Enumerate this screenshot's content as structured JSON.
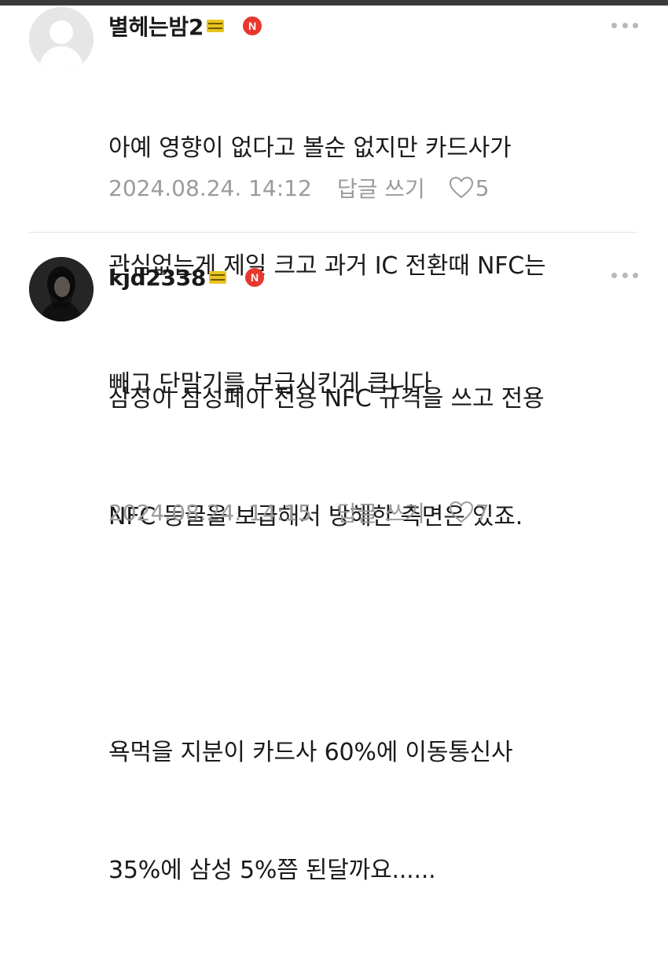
{
  "comments": [
    {
      "username": "별헤는밤2",
      "badge": "N",
      "lines": [
        "아예 영향이 없다고 볼순 없지만 카드사가",
        "관심없는게 제일 크고 과거 IC 전환때 NFC는",
        "빼고 단말기를 보급시킨게 큽니다"
      ],
      "timestamp": "2024.08.24. 14:12",
      "reply_label": "답글 쓰기",
      "likes": "5",
      "avatar": "default-user-avatar"
    },
    {
      "username": "kjd2338",
      "badge": "N",
      "lines": [
        "삼성이 삼성페이 전용 NFC 규격을 쓰고 전용",
        "NFC 동글을 보급해서 방해한 측면은 있죠.",
        "",
        "욕먹을 지분이 카드사 60%에 이동통신사",
        "35%에 삼성 5%쯤 된달까요......"
      ],
      "timestamp": "2024.08.24. 14:15",
      "reply_label": "답글 쓰기",
      "likes": "7",
      "avatar": "profile-photo-avatar"
    }
  ],
  "colors": {
    "badge_n": "#e8382e",
    "level_badge": "#e8c41e",
    "meta_text": "#9b9b9b",
    "divider": "#e4e4e4"
  },
  "icons": {
    "more": "more-dots-icon",
    "like": "heart-outline-icon"
  }
}
